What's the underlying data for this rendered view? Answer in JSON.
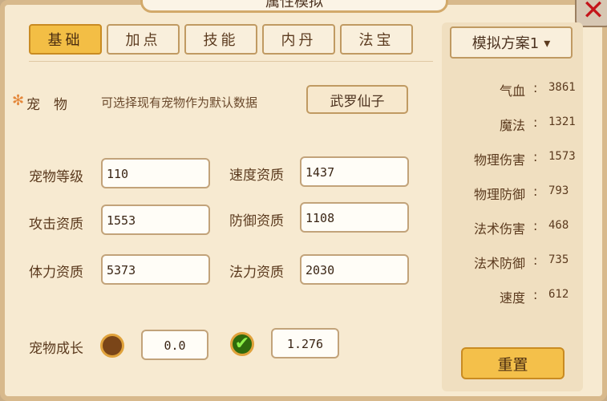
{
  "window": {
    "title": "属性模拟"
  },
  "tabs": [
    {
      "label": "基础",
      "active": true
    },
    {
      "label": "加点",
      "active": false
    },
    {
      "label": "技能",
      "active": false
    },
    {
      "label": "内丹",
      "active": false
    },
    {
      "label": "法宝",
      "active": false
    }
  ],
  "pet": {
    "label": "宠　物",
    "hint": "可选择现有宠物作为默认数据",
    "selected": "武罗仙子"
  },
  "fields": {
    "level": {
      "label": "宠物等级",
      "value": "110"
    },
    "speed_aptitude": {
      "label": "速度资质",
      "value": "1437"
    },
    "attack_aptitude": {
      "label": "攻击资质",
      "value": "1553"
    },
    "defense_aptitude": {
      "label": "防御资质",
      "value": "1108"
    },
    "stamina_aptitude": {
      "label": "体力资质",
      "value": "5373"
    },
    "magic_aptitude": {
      "label": "法力资质",
      "value": "2030"
    }
  },
  "growth": {
    "label": "宠物成长",
    "option_a_value": "0.0",
    "option_b_value": "1.276",
    "selected": "option_b"
  },
  "scheme": {
    "label": "模拟方案1"
  },
  "stats": [
    {
      "label": "气血",
      "value": "3861"
    },
    {
      "label": "魔法",
      "value": "1321"
    },
    {
      "label": "物理伤害",
      "value": "1573"
    },
    {
      "label": "物理防御",
      "value": "793"
    },
    {
      "label": "法术伤害",
      "value": "468"
    },
    {
      "label": "法术防御",
      "value": "735"
    },
    {
      "label": "速度",
      "value": "612"
    }
  ],
  "reset_label": "重置",
  "colors": {
    "accent": "#f3be45",
    "check": "#2f6a0c",
    "close": "#c4141a"
  }
}
